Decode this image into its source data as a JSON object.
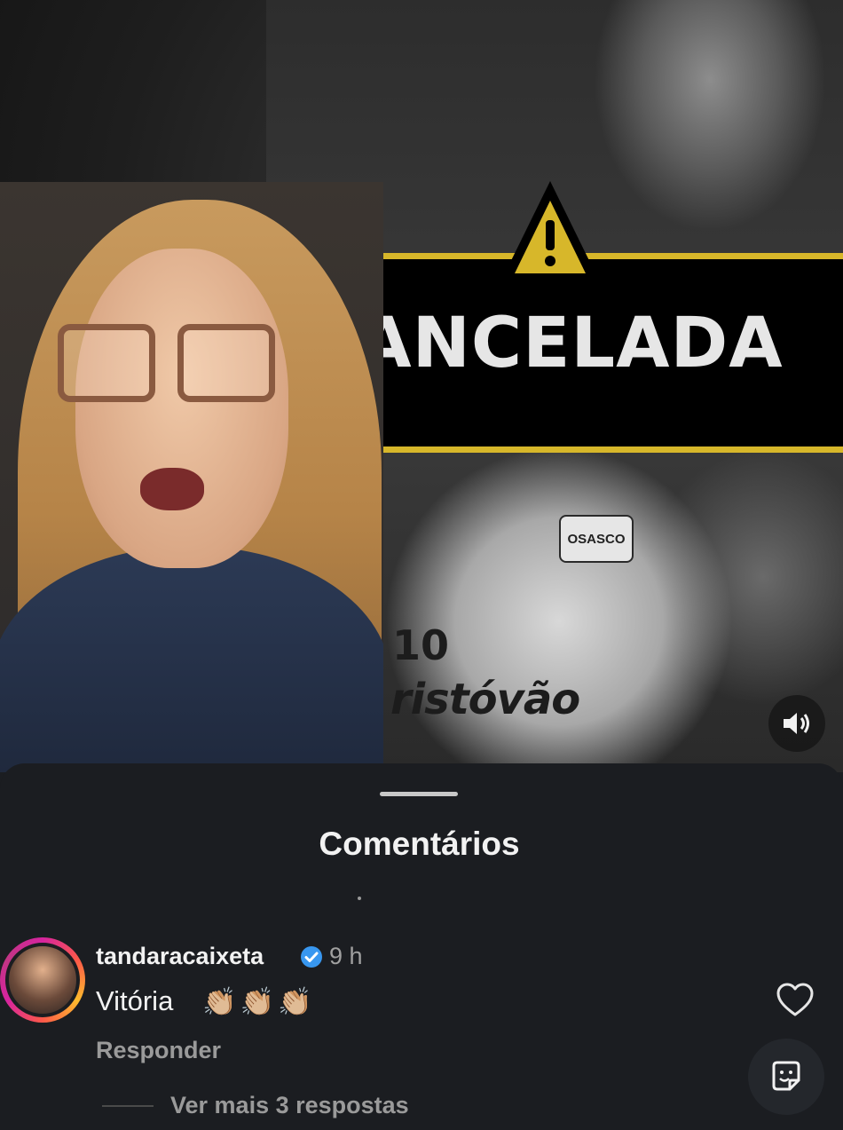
{
  "video": {
    "banner_text": "CANCELADA",
    "jersey_badge": "OSASCO",
    "jersey_line1": "10",
    "jersey_line2": "ristóvão",
    "sound_icon": "speaker-icon"
  },
  "comments_sheet": {
    "title": "Comentários",
    "comment": {
      "username": "tandaracaixeta",
      "verified_icon": "verified-badge-icon",
      "time": "9 h",
      "text": "Vitória",
      "emojis": "👏🏼👏🏼👏🏼",
      "reply_label": "Responder",
      "like_icon": "heart-icon",
      "more_replies_label": "Ver mais 3 respostas"
    },
    "gif_icon": "sticker-icon"
  },
  "colors": {
    "banner_accent": "#d7b72a",
    "sheet_bg": "#1b1d21",
    "verified_blue": "#3897f0"
  }
}
